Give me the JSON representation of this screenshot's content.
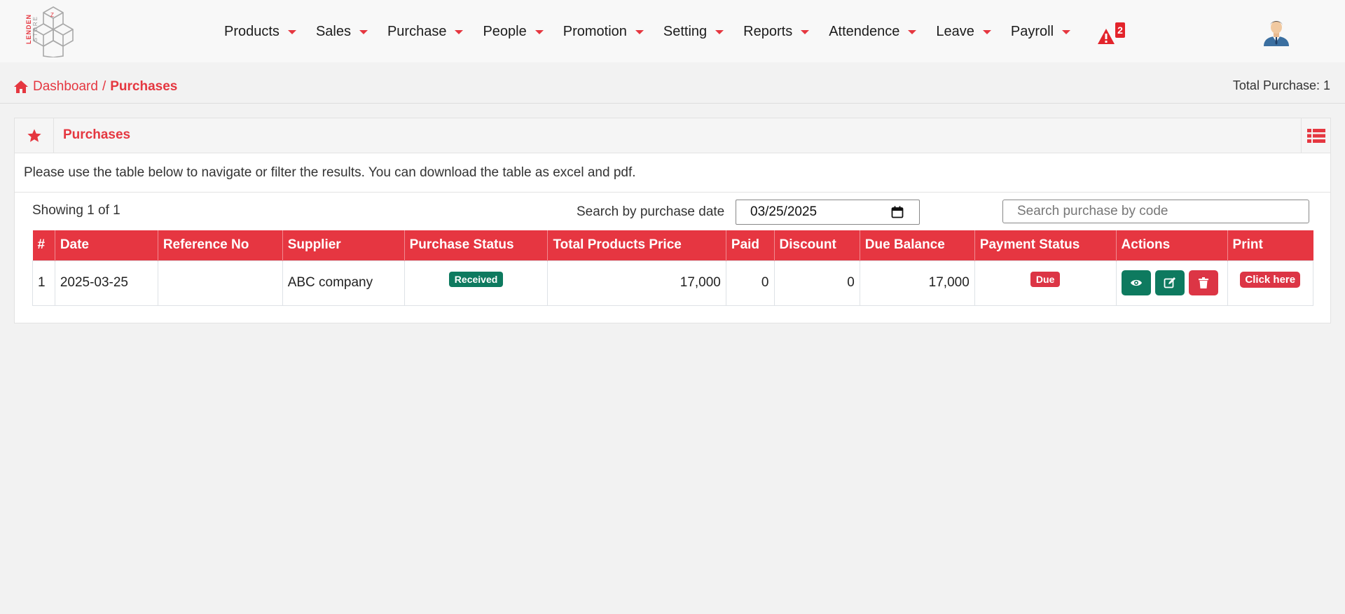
{
  "header": {
    "brand_top": "LENDEN",
    "brand_bottom": "STORE",
    "menu": [
      "Products",
      "Sales",
      "Purchase",
      "People",
      "Promotion",
      "Setting",
      "Reports",
      "Attendence",
      "Leave",
      "Payroll"
    ],
    "alert_count": "2",
    "accent": "#e53740"
  },
  "breadcrumb": {
    "home": "Dashboard",
    "separator": "/",
    "current": "Purchases"
  },
  "total_purchase": "Total Purchase: 1",
  "panel": {
    "title": "Purchases",
    "intro": "Please use the table below to navigate or filter the results. You can download the table as excel and pdf.",
    "showing": "Showing 1 of 1",
    "date_label": "Search by purchase date",
    "date_value": "03/25/2025",
    "search_placeholder": "Search purchase by code"
  },
  "table": {
    "headers": [
      "#",
      "Date",
      "Reference No",
      "Supplier",
      "Purchase Status",
      "Total Products Price",
      "Paid",
      "Discount",
      "Due Balance",
      "Payment Status",
      "Actions",
      "Print"
    ],
    "rows": [
      {
        "index": "1",
        "date": "2025-03-25",
        "reference": "",
        "supplier": "ABC company",
        "purchase_status": "Received",
        "total_price": "17,000",
        "paid": "0",
        "discount": "0",
        "due_balance": "17,000",
        "payment_status": "Due",
        "print_label": "Click here"
      }
    ]
  },
  "colors": {
    "header_bg": "#e63641",
    "success": "#0e7a5f",
    "danger": "#dc3545"
  }
}
